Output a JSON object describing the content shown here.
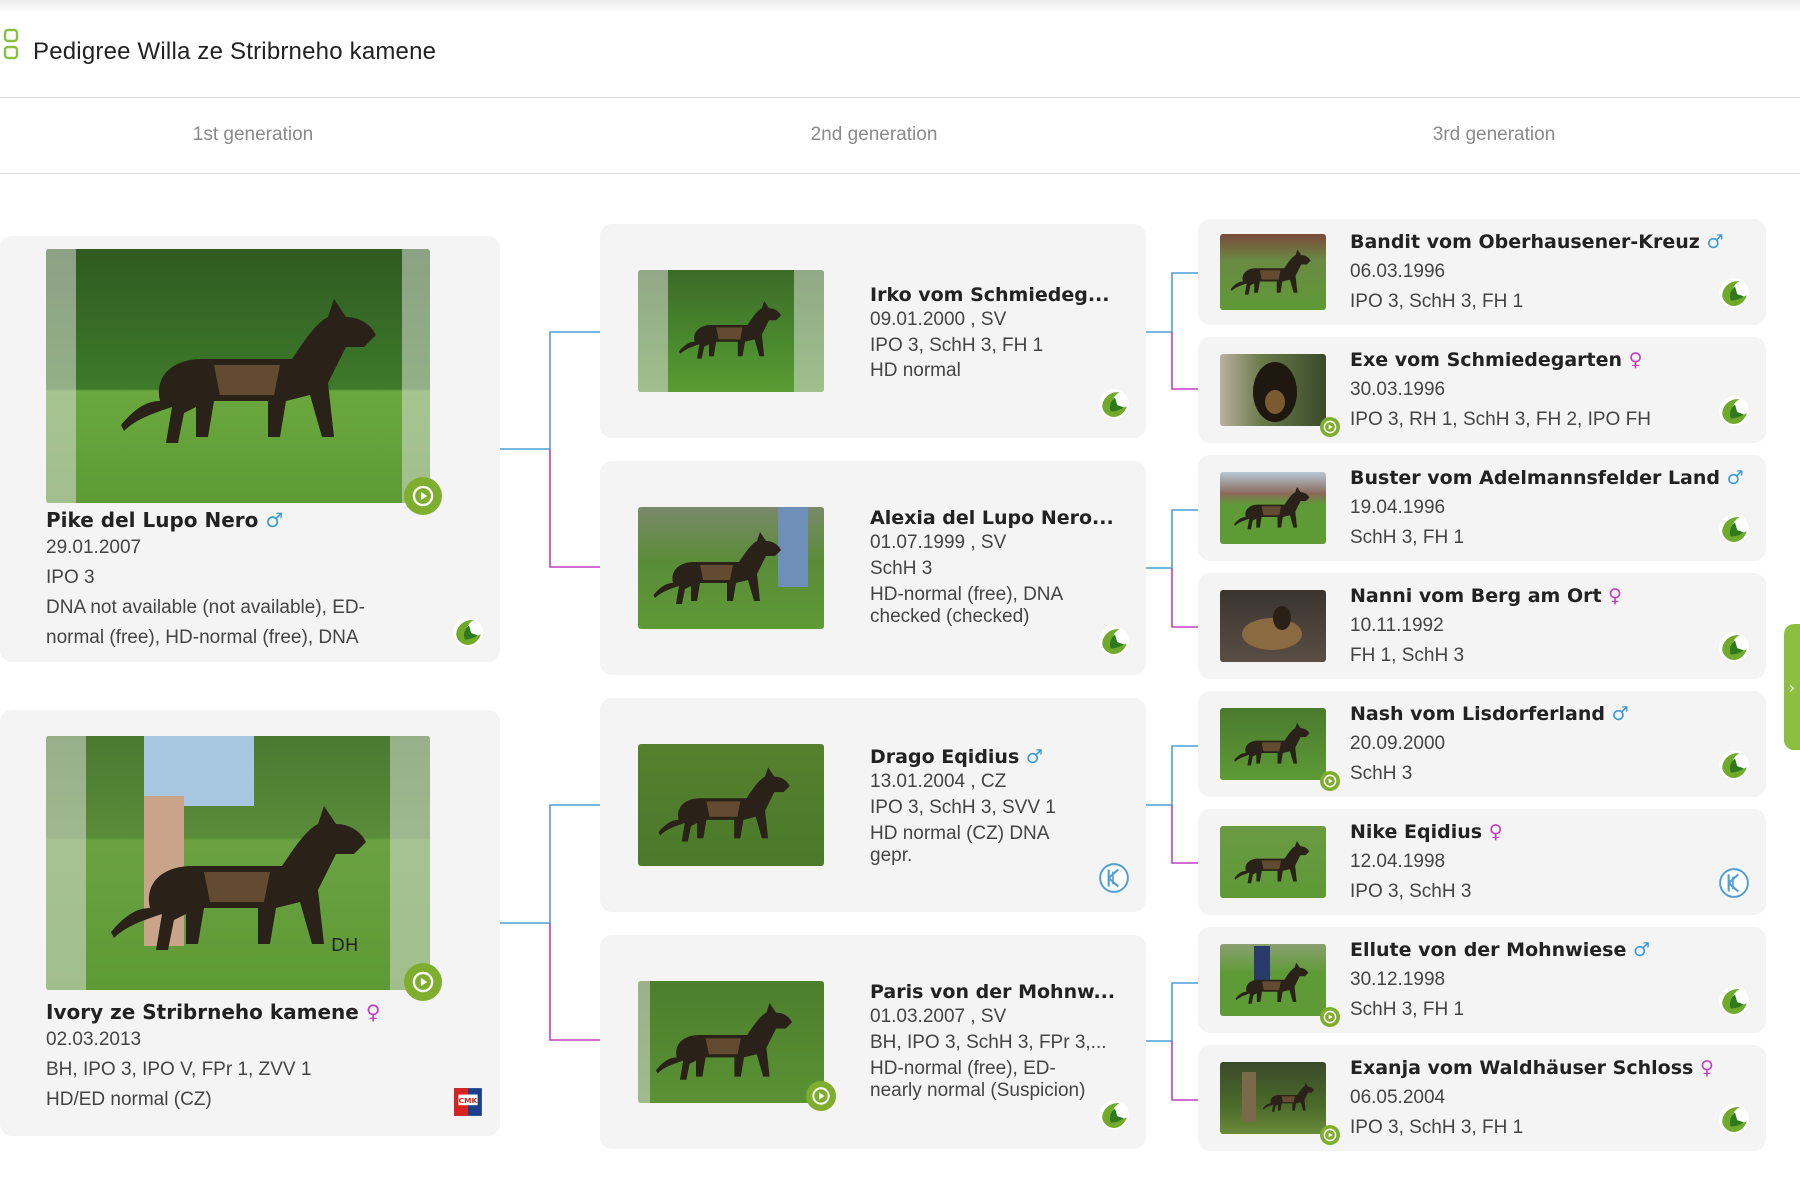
{
  "page": {
    "title": "Pedigree Willa ze Stribrneho kamene"
  },
  "generations": [
    "1st generation",
    "2nd generation",
    "3rd generation"
  ],
  "colors": {
    "male": "#3d9ad8",
    "female": "#c23fc2",
    "accent": "#7fae2e"
  },
  "gen1": [
    {
      "name": "Pike del Lupo Nero",
      "sex": "♂",
      "lines": [
        "29.01.2007",
        "IPO 3",
        "DNA not available (not available), ED-",
        "normal (free), HD-normal (free), DNA"
      ],
      "flag": "sv-breed-survey-icon",
      "video": true
    },
    {
      "name": "Ivory ze Stribrneho kamene",
      "sex": "♀",
      "lines": [
        "02.03.2013",
        "BH, IPO 3, IPO V, FPr 1, ZVV 1",
        "HD/ED normal (CZ)"
      ],
      "flag": "cmku-icon",
      "video": true
    }
  ],
  "gen2": [
    {
      "name": "Irko vom Schmiedeg...",
      "lines": [
        "09.01.2000 , SV",
        "IPO 3, SchH 3, FH 1",
        "HD normal"
      ],
      "flag": "sv-breed-survey-icon",
      "video": false
    },
    {
      "name": "Alexia del Lupo Nero...",
      "lines": [
        "01.07.1999 , SV",
        "SchH 3",
        "HD-normal (free), DNA",
        "checked (checked)"
      ],
      "flag": "sv-breed-survey-icon",
      "video": false
    },
    {
      "name": "Drago Eqidius",
      "sex": "♂",
      "lines": [
        "13.01.2004 , CZ",
        "IPO 3, SchH 3, SVV 1",
        "HD normal (CZ) DNA",
        "gepr."
      ],
      "flag": "kk-icon",
      "video": false
    },
    {
      "name": "Paris von der Mohnw...",
      "lines": [
        "01.03.2007 , SV",
        "BH, IPO 3, SchH 3, FPr 3,...",
        "HD-normal (free), ED-",
        "nearly normal (Suspicion)"
      ],
      "flag": "sv-breed-survey-icon",
      "video": true
    }
  ],
  "gen3": [
    {
      "name": "Bandit vom Oberhausener-Kreuz",
      "sex": "♂",
      "date": "06.03.1996",
      "titles": "IPO 3, SchH 3, FH 1",
      "flag": "sv-breed-survey-icon",
      "video": false
    },
    {
      "name": "Exe vom Schmiedegarten",
      "sex": "♀",
      "date": "30.03.1996",
      "titles": "IPO 3, RH 1, SchH 3, FH 2, IPO FH",
      "flag": "sv-breed-survey-icon",
      "video": true
    },
    {
      "name": "Buster vom Adelmannsfelder Land",
      "sex": "♂",
      "date": "19.04.1996",
      "titles": "SchH 3, FH 1",
      "flag": "sv-breed-survey-icon",
      "video": false
    },
    {
      "name": "Nanni vom Berg am Ort",
      "sex": "♀",
      "date": "10.11.1992",
      "titles": "FH 1, SchH 3",
      "flag": "sv-breed-survey-icon",
      "video": false
    },
    {
      "name": "Nash vom Lisdorferland",
      "sex": "♂",
      "date": "20.09.2000",
      "titles": "SchH 3",
      "flag": "sv-breed-survey-icon",
      "video": true
    },
    {
      "name": "Nike Eqidius",
      "sex": "♀",
      "date": "12.04.1998",
      "titles": "IPO 3, SchH 3",
      "flag": "kk-icon",
      "video": false
    },
    {
      "name": "Ellute von der Mohnwiese",
      "sex": "♂",
      "date": "30.12.1998",
      "titles": "SchH 3, FH 1",
      "flag": "sv-breed-survey-icon",
      "video": true
    },
    {
      "name": "Exanja vom Waldhäuser Schloss",
      "sex": "♀",
      "date": "06.05.2004",
      "titles": "IPO 3, SchH 3, FH 1",
      "flag": "sv-breed-survey-icon",
      "video": true
    }
  ],
  "sidetab": {
    "arrow": "›"
  }
}
